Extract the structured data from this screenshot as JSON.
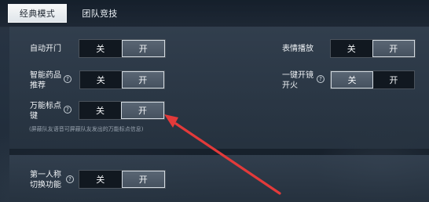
{
  "tabs": [
    {
      "label": "经典模式"
    },
    {
      "label": "团队竞技"
    }
  ],
  "settings": {
    "auto_door": {
      "label": "自动开门",
      "off_label": "关",
      "on_label": "开"
    },
    "emote_play": {
      "label": "表情播放",
      "off_label": "关",
      "on_label": "开"
    },
    "smart_medicine": {
      "label_line1": "智能药品",
      "label_line2": "推荐",
      "off_label": "关",
      "on_label": "开"
    },
    "one_key_scope": {
      "label_line1": "一键开镜",
      "label_line2": "开火",
      "off_label": "关",
      "on_label": "开"
    },
    "universal_mark": {
      "label_line1": "万能标点",
      "label_line2": "键",
      "off_label": "关",
      "on_label": "开",
      "note": "(屏蔽队友语音可屏蔽队友发出的万能标点信息)"
    },
    "first_person": {
      "label_line1": "第一人称",
      "label_line2": "切换功能",
      "off_label": "关",
      "on_label": "开"
    }
  },
  "icons": {
    "help": "?"
  },
  "colors": {
    "annotation_arrow": "#e33a3a"
  }
}
